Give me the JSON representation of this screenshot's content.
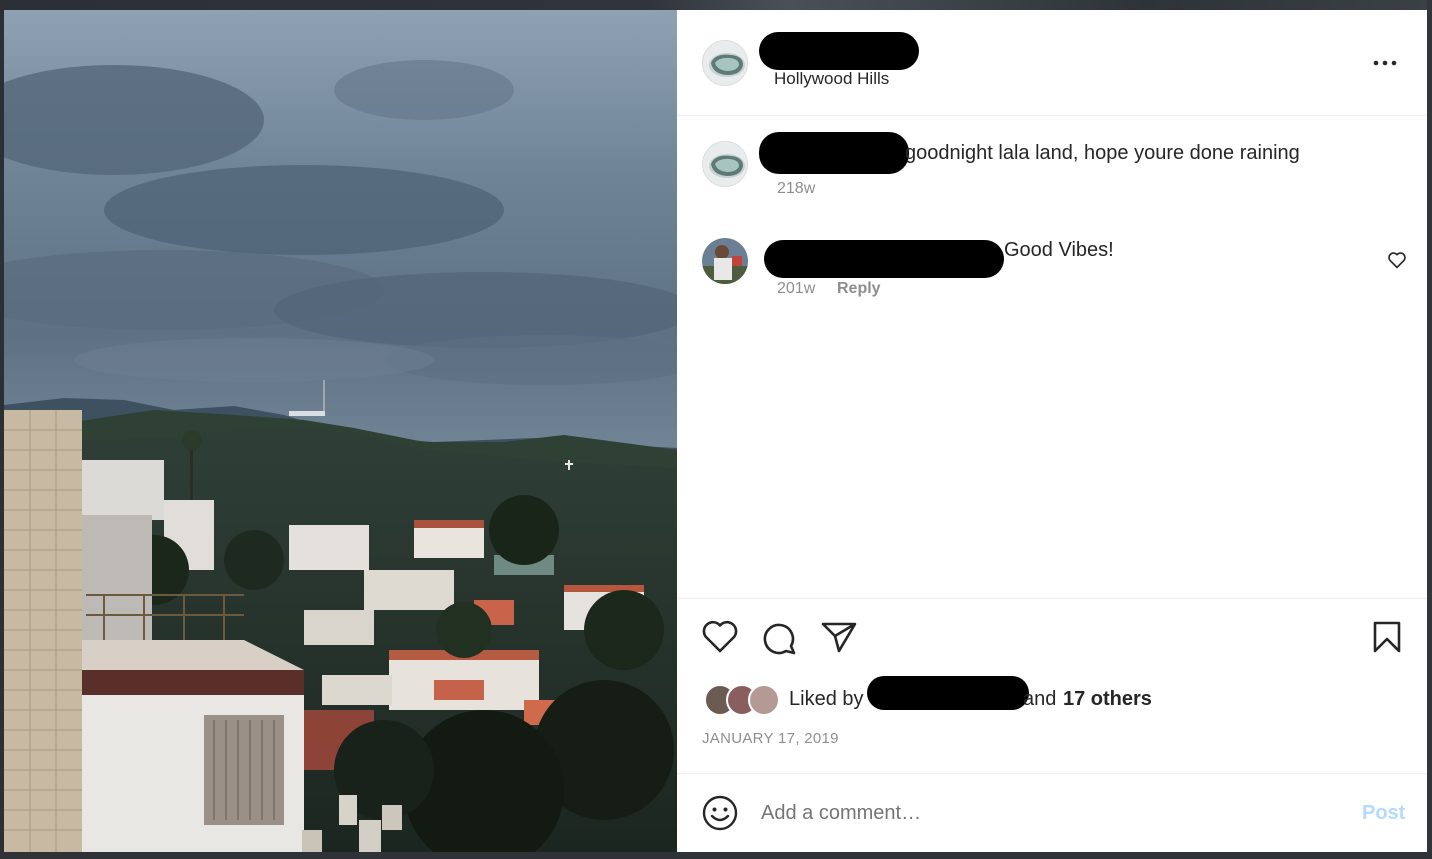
{
  "post": {
    "location": "Hollywood Hills",
    "more_icon": "more-horizontal-icon"
  },
  "caption": {
    "text": "goodnight lala land, hope youre done raining",
    "age": "218w"
  },
  "comments": [
    {
      "text": "Good Vibes!",
      "age": "201w",
      "reply_label": "Reply"
    }
  ],
  "actions": {
    "icons": [
      "heart-icon",
      "comment-icon",
      "share-icon",
      "bookmark-icon"
    ]
  },
  "likes": {
    "prefix": "Liked by",
    "suffix_and": "and",
    "others": "17 others"
  },
  "date": "JANUARY 17, 2019",
  "composer": {
    "placeholder": "Add a comment…",
    "post_label": "Post",
    "post_color": "#b3dbff"
  }
}
